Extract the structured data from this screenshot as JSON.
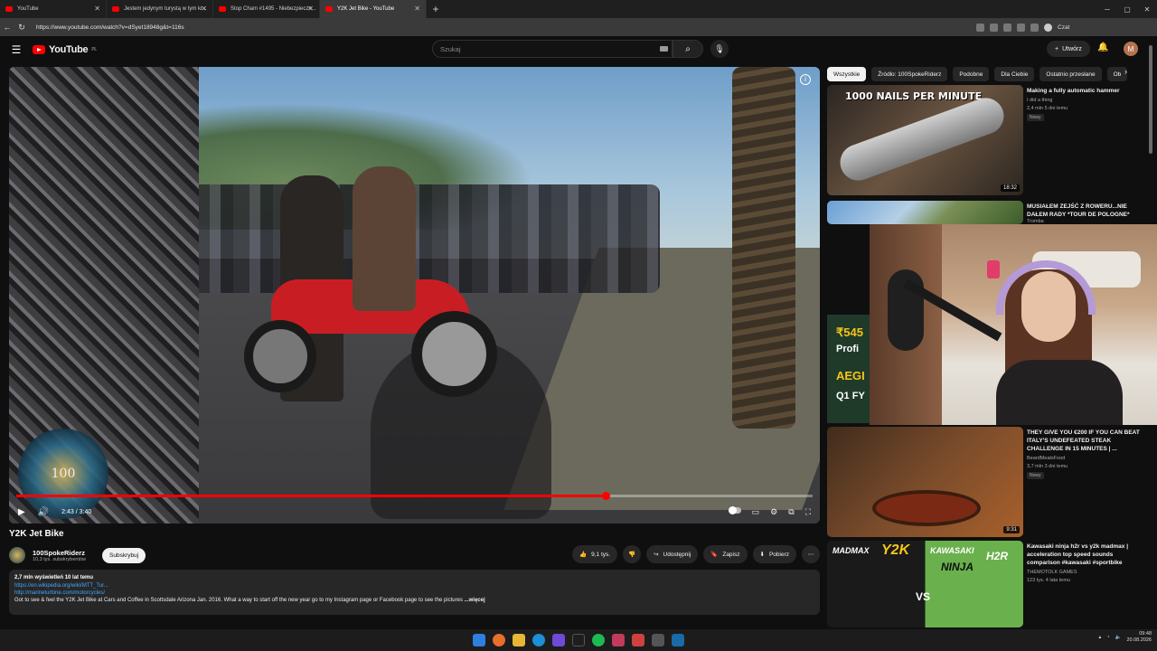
{
  "browser": {
    "tabs": [
      {
        "label": "YouTube",
        "active": false
      },
      {
        "label": "Jestem jedynym turystą w tym kr...",
        "active": false
      },
      {
        "label": "Stop Cham #1495 - Niebezpieczn...",
        "active": false
      },
      {
        "label": "Y2K Jet Bike - YouTube",
        "active": true
      }
    ],
    "url": "https://www.youtube.com/watch?v=dSyet18948g&t=116s",
    "profile_label": "Czat"
  },
  "youtube": {
    "logo": "YouTube",
    "region": "PL",
    "search_placeholder": "Szukaj",
    "create_label": "Utwórz",
    "account_initial": "M"
  },
  "player": {
    "time": "2:43 / 3:40",
    "progress": 0.74,
    "badge_text": "100"
  },
  "video": {
    "title": "Y2K Jet Bike",
    "channel": "100SpokeRiderz",
    "subscribers": "10,3 tys. subskrybentów",
    "subscribe_label": "Subskrybuj",
    "likes": "9,1 tys.",
    "share_label": "Udostępnij",
    "save_label": "Zapisz",
    "download_label": "Pobierz",
    "views_age": "2,7 mln wyświetleń  10 lat temu",
    "links": [
      "https://en.wikipedia.org/wiki/MTT_Tur...",
      "http://marineturbine.com/motorcycles/"
    ],
    "description": "Got to see & feel the Y2K Jet Bike at Cars and Coffee in Scottsdale Arizona Jan. 2016. What a way to start off the new year go to my Instagram page or Facebook page to see the pictures",
    "more_label": "...więcej"
  },
  "chips": [
    "Wszystkie",
    "Źródło: 100SpokeRiderz",
    "Podobne",
    "Dla Ciebie",
    "Ostatnio przesłane",
    "Ob"
  ],
  "sidebar": {
    "items": [
      {
        "title": "Making a fully automatic hammer",
        "channel": "I did a thing",
        "meta": "2,4 mln  5 dni temu",
        "badge": "Nowy",
        "duration": "18:32",
        "thumb_text": "1000 NAILS PER MINUTE"
      },
      {
        "title": "MUSIAŁEM ZEJŚĆ Z ROWERU...NIE DAŁEM RADY *TOUR DE POLOGNE*",
        "channel": "Tromba",
        "meta": "",
        "badge": "",
        "duration": "",
        "thumb_text": ""
      },
      {
        "title": "THEY GIVE YOU €200 IF YOU CAN BEAT ITALY'S UNDEFEATED STEAK CHALLENGE IN 15 MINUTES | ...",
        "channel": "BeardMeatsFood",
        "meta": "3,7 mln  3 dni temu",
        "badge": "Nowy",
        "duration": "9:31",
        "thumb_text": ""
      },
      {
        "title": "Kawasaki ninja h2r vs y2k madmax | acceleration top speed sounds comparison #kawasaki #sportbike",
        "channel": "THEMOTOLK GAMES",
        "meta": "123 tys.  4 lata temu",
        "badge": "",
        "duration": "",
        "thumb_text": ""
      }
    ],
    "ad_text": [
      "₹545",
      "Profi",
      "AEGI",
      "Q1 FY"
    ],
    "thumb5": {
      "a": "MADMAX",
      "b": "Y2K",
      "c": "KAWASAKI",
      "d": "NINJA",
      "e": "H2R",
      "vs": "VS"
    }
  },
  "taskbar": {
    "time": "09:48",
    "date": "20.08.2026"
  }
}
